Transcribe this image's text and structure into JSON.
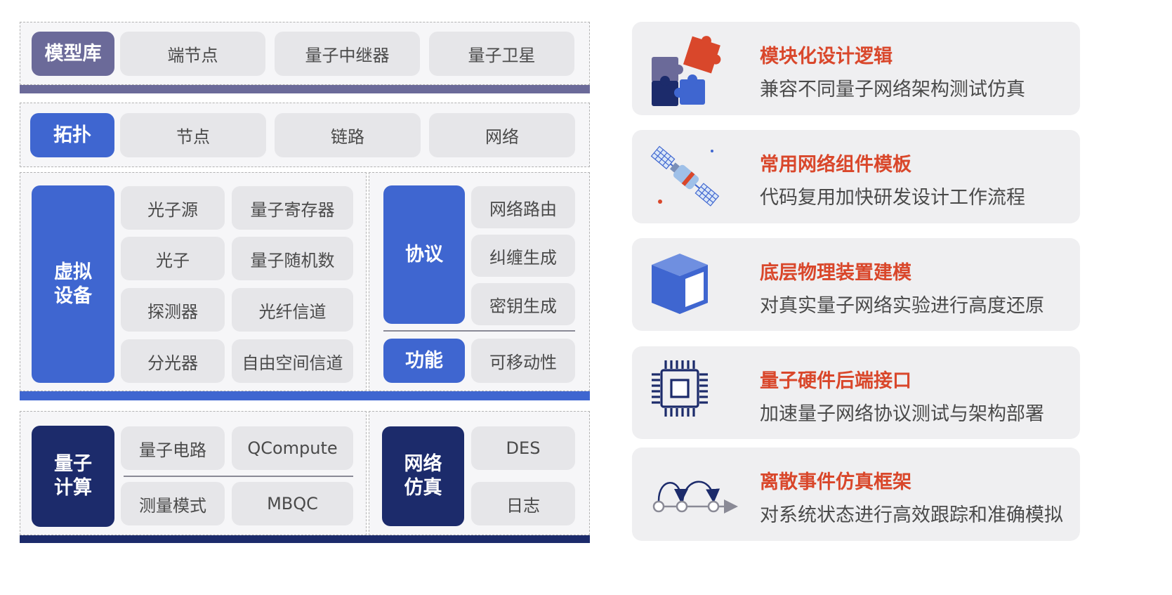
{
  "colors": {
    "model_lib": "#6b6a99",
    "blue": "#3f66d0",
    "navy": "#1c2b6b",
    "accent_title": "#d9472b"
  },
  "model_library": {
    "label": "模型库",
    "items": [
      "端节点",
      "量子中继器",
      "量子卫星"
    ]
  },
  "topology": {
    "label": "拓扑",
    "items": [
      "节点",
      "链路",
      "网络"
    ]
  },
  "virtual_devices": {
    "label_line1": "虚拟",
    "label_line2": "设备",
    "items": [
      "光子源",
      "量子寄存器",
      "光子",
      "量子随机数",
      "探测器",
      "光纤信道",
      "分光器",
      "自由空间信道"
    ]
  },
  "protocol": {
    "label": "协议",
    "items": [
      "网络路由",
      "纠缠生成",
      "密钥生成"
    ]
  },
  "function": {
    "label": "功能",
    "items": [
      "可移动性"
    ]
  },
  "quantum_computing": {
    "label_line1": "量子",
    "label_line2": "计算",
    "items": [
      "量子电路",
      "QCompute",
      "测量模式",
      "MBQC"
    ]
  },
  "network_simulation": {
    "label_line1": "网络",
    "label_line2": "仿真",
    "items": [
      "DES",
      "日志"
    ]
  },
  "features": [
    {
      "icon": "puzzle-icon",
      "title": "模块化设计逻辑",
      "desc": "兼容不同量子网络架构测试仿真"
    },
    {
      "icon": "satellite-icon",
      "title": "常用网络组件模板",
      "desc": "代码复用加快研发设计工作流程"
    },
    {
      "icon": "cube-icon",
      "title": "底层物理装置建模",
      "desc": "对真实量子网络实验进行高度还原"
    },
    {
      "icon": "chip-icon",
      "title": "量子硬件后端接口",
      "desc": "加速量子网络协议测试与架构部署"
    },
    {
      "icon": "event-flow-icon",
      "title": "离散事件仿真框架",
      "desc": "对系统状态进行高效跟踪和准确模拟"
    }
  ]
}
